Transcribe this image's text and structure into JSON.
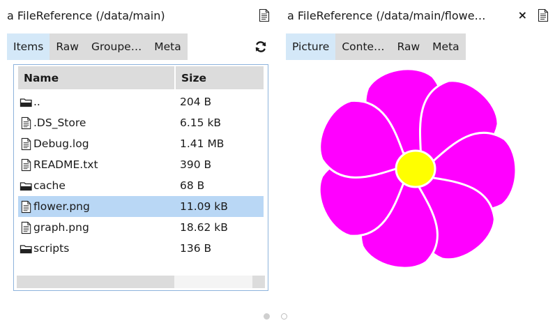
{
  "left_pane": {
    "title": "a FileReference (/data/main)",
    "tabs": [
      {
        "label": "Items",
        "active": true
      },
      {
        "label": "Raw",
        "active": false
      },
      {
        "label": "Groupe…",
        "active": false
      },
      {
        "label": "Meta",
        "active": false
      }
    ],
    "table": {
      "columns": [
        "Name",
        "Size"
      ],
      "rows": [
        {
          "name": "..",
          "size": "204 B",
          "icon": "folder-icon",
          "selected": false
        },
        {
          "name": ".DS_Store",
          "size": "6.15 kB",
          "icon": "document-icon",
          "selected": false
        },
        {
          "name": "Debug.log",
          "size": "1.41 MB",
          "icon": "document-icon",
          "selected": false
        },
        {
          "name": "README.txt",
          "size": "390 B",
          "icon": "document-icon",
          "selected": false
        },
        {
          "name": "cache",
          "size": "68 B",
          "icon": "folder-icon",
          "selected": false
        },
        {
          "name": "flower.png",
          "size": "11.09 kB",
          "icon": "document-icon",
          "selected": true
        },
        {
          "name": "graph.png",
          "size": "18.62 kB",
          "icon": "document-icon",
          "selected": false
        },
        {
          "name": "scripts",
          "size": "136 B",
          "icon": "folder-icon",
          "selected": false
        }
      ]
    }
  },
  "right_pane": {
    "title": "a FileReference (/data/main/flowe…",
    "close_label": "×",
    "tabs": [
      {
        "label": "Picture",
        "active": true
      },
      {
        "label": "Conte…",
        "active": false
      },
      {
        "label": "Raw",
        "active": false
      },
      {
        "label": "Meta",
        "active": false
      }
    ]
  },
  "icons": {
    "document": "document-icon",
    "folder": "folder-icon",
    "refresh": "refresh-icon",
    "flower": "flower-image"
  },
  "colors": {
    "tab_active": "#d4e8f8",
    "tab_inactive": "#dcdcdc",
    "selection": "#b9d7f5",
    "table_border": "#8db3dc",
    "petal": "#ff00ff",
    "flower_center": "#ffff00"
  },
  "pager": {
    "pages": 2,
    "current": 1
  }
}
